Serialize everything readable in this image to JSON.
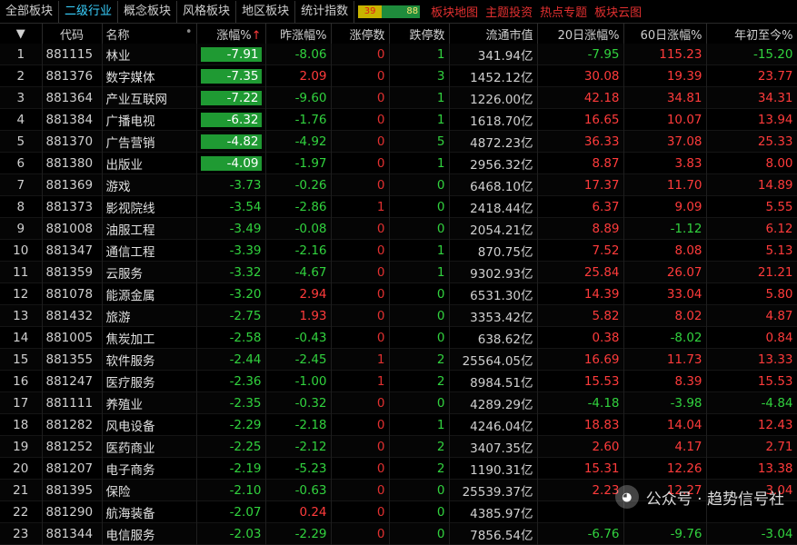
{
  "tabs": [
    {
      "label": "全部板块",
      "active": false
    },
    {
      "label": "二级行业",
      "active": true
    },
    {
      "label": "概念板块",
      "active": false
    },
    {
      "label": "风格板块",
      "active": false
    },
    {
      "label": "地区板块",
      "active": false
    },
    {
      "label": "统计指数",
      "active": false
    }
  ],
  "counts": {
    "up": "39",
    "down": "88"
  },
  "links": [
    "板块地图",
    "主题投资",
    "热点专题",
    "板块云图"
  ],
  "headers": {
    "expand": "▼",
    "code": "代码",
    "name": "名称",
    "change": "涨幅%",
    "change_arrow": "↑",
    "prev_change": "昨涨幅%",
    "limit_up": "涨停数",
    "limit_down": "跌停数",
    "market_cap": "流通市值",
    "chg20": "20日涨幅%",
    "chg60": "60日涨幅%",
    "ytd": "年初至今%"
  },
  "rows": [
    {
      "no": "1",
      "code": "881115",
      "name": "林业",
      "chg": "-7.91",
      "prev": "-8.06",
      "lu": "0",
      "ld": "1",
      "cap": "341.94亿",
      "c20": "-7.95",
      "c60": "115.23",
      "ytd": "-15.20",
      "hl": true
    },
    {
      "no": "2",
      "code": "881376",
      "name": "数字媒体",
      "chg": "-7.35",
      "prev": "2.09",
      "lu": "0",
      "ld": "3",
      "cap": "1452.12亿",
      "c20": "30.08",
      "c60": "19.39",
      "ytd": "23.77",
      "hl": true
    },
    {
      "no": "3",
      "code": "881364",
      "name": "产业互联网",
      "chg": "-7.22",
      "prev": "-9.60",
      "lu": "0",
      "ld": "1",
      "cap": "1226.00亿",
      "c20": "42.18",
      "c60": "34.81",
      "ytd": "34.31",
      "hl": true
    },
    {
      "no": "4",
      "code": "881384",
      "name": "广播电视",
      "chg": "-6.32",
      "prev": "-1.76",
      "lu": "0",
      "ld": "1",
      "cap": "1618.70亿",
      "c20": "16.65",
      "c60": "10.07",
      "ytd": "13.94",
      "hl": true
    },
    {
      "no": "5",
      "code": "881370",
      "name": "广告营销",
      "chg": "-4.82",
      "prev": "-4.92",
      "lu": "0",
      "ld": "5",
      "cap": "4872.23亿",
      "c20": "36.33",
      "c60": "37.08",
      "ytd": "25.33",
      "hl": true
    },
    {
      "no": "6",
      "code": "881380",
      "name": "出版业",
      "chg": "-4.09",
      "prev": "-1.97",
      "lu": "0",
      "ld": "1",
      "cap": "2956.32亿",
      "c20": "8.87",
      "c60": "3.83",
      "ytd": "8.00",
      "hl": true
    },
    {
      "no": "7",
      "code": "881369",
      "name": "游戏",
      "chg": "-3.73",
      "prev": "-0.26",
      "lu": "0",
      "ld": "0",
      "cap": "6468.10亿",
      "c20": "17.37",
      "c60": "11.70",
      "ytd": "14.89",
      "hl": false
    },
    {
      "no": "8",
      "code": "881373",
      "name": "影视院线",
      "chg": "-3.54",
      "prev": "-2.86",
      "lu": "1",
      "ld": "0",
      "cap": "2418.44亿",
      "c20": "6.37",
      "c60": "9.09",
      "ytd": "5.55",
      "hl": false
    },
    {
      "no": "9",
      "code": "881008",
      "name": "油服工程",
      "chg": "-3.49",
      "prev": "-0.08",
      "lu": "0",
      "ld": "0",
      "cap": "2054.21亿",
      "c20": "8.89",
      "c60": "-1.12",
      "ytd": "6.12",
      "hl": false
    },
    {
      "no": "10",
      "code": "881347",
      "name": "通信工程",
      "chg": "-3.39",
      "prev": "-2.16",
      "lu": "0",
      "ld": "1",
      "cap": "870.75亿",
      "c20": "7.52",
      "c60": "8.08",
      "ytd": "5.13",
      "hl": false
    },
    {
      "no": "11",
      "code": "881359",
      "name": "云服务",
      "chg": "-3.32",
      "prev": "-4.67",
      "lu": "0",
      "ld": "1",
      "cap": "9302.93亿",
      "c20": "25.84",
      "c60": "26.07",
      "ytd": "21.21",
      "hl": false
    },
    {
      "no": "12",
      "code": "881078",
      "name": "能源金属",
      "chg": "-3.20",
      "prev": "2.94",
      "lu": "0",
      "ld": "0",
      "cap": "6531.30亿",
      "c20": "14.39",
      "c60": "33.04",
      "ytd": "5.80",
      "hl": false
    },
    {
      "no": "13",
      "code": "881432",
      "name": "旅游",
      "chg": "-2.75",
      "prev": "1.93",
      "lu": "0",
      "ld": "0",
      "cap": "3353.42亿",
      "c20": "5.82",
      "c60": "8.02",
      "ytd": "4.87",
      "hl": false
    },
    {
      "no": "14",
      "code": "881005",
      "name": "焦炭加工",
      "chg": "-2.58",
      "prev": "-0.43",
      "lu": "0",
      "ld": "0",
      "cap": "638.62亿",
      "c20": "0.38",
      "c60": "-8.02",
      "ytd": "0.84",
      "hl": false
    },
    {
      "no": "15",
      "code": "881355",
      "name": "软件服务",
      "chg": "-2.44",
      "prev": "-2.45",
      "lu": "1",
      "ld": "2",
      "cap": "25564.05亿",
      "c20": "16.69",
      "c60": "11.73",
      "ytd": "13.33",
      "hl": false
    },
    {
      "no": "16",
      "code": "881247",
      "name": "医疗服务",
      "chg": "-2.36",
      "prev": "-1.00",
      "lu": "1",
      "ld": "2",
      "cap": "8984.51亿",
      "c20": "15.53",
      "c60": "8.39",
      "ytd": "15.53",
      "hl": false
    },
    {
      "no": "17",
      "code": "881111",
      "name": "养殖业",
      "chg": "-2.35",
      "prev": "-0.32",
      "lu": "0",
      "ld": "0",
      "cap": "4289.29亿",
      "c20": "-4.18",
      "c60": "-3.98",
      "ytd": "-4.84",
      "hl": false
    },
    {
      "no": "18",
      "code": "881282",
      "name": "风电设备",
      "chg": "-2.29",
      "prev": "-2.18",
      "lu": "0",
      "ld": "1",
      "cap": "4246.04亿",
      "c20": "18.83",
      "c60": "14.04",
      "ytd": "12.43",
      "hl": false
    },
    {
      "no": "19",
      "code": "881252",
      "name": "医药商业",
      "chg": "-2.25",
      "prev": "-2.12",
      "lu": "0",
      "ld": "2",
      "cap": "3407.35亿",
      "c20": "2.60",
      "c60": "4.17",
      "ytd": "2.71",
      "hl": false
    },
    {
      "no": "20",
      "code": "881207",
      "name": "电子商务",
      "chg": "-2.19",
      "prev": "-5.23",
      "lu": "0",
      "ld": "2",
      "cap": "1190.31亿",
      "c20": "15.31",
      "c60": "12.26",
      "ytd": "13.38",
      "hl": false
    },
    {
      "no": "21",
      "code": "881395",
      "name": "保险",
      "chg": "-2.10",
      "prev": "-0.63",
      "lu": "0",
      "ld": "0",
      "cap": "25539.37亿",
      "c20": "2.23",
      "c60": "12.27",
      "ytd": "3.04",
      "hl": false
    },
    {
      "no": "22",
      "code": "881290",
      "name": "航海装备",
      "chg": "-2.07",
      "prev": "0.24",
      "lu": "0",
      "ld": "0",
      "cap": "4385.97亿",
      "c20": "",
      "c60": "",
      "ytd": "",
      "hl": false
    },
    {
      "no": "23",
      "code": "881344",
      "name": "电信服务",
      "chg": "-2.03",
      "prev": "-2.29",
      "lu": "0",
      "ld": "0",
      "cap": "7856.54亿",
      "c20": "-6.76",
      "c60": "-9.76",
      "ytd": "-3.04",
      "hl": false
    }
  ],
  "watermark": {
    "icon": "wechat-icon",
    "text": "公众号 · 趋势信号社"
  }
}
